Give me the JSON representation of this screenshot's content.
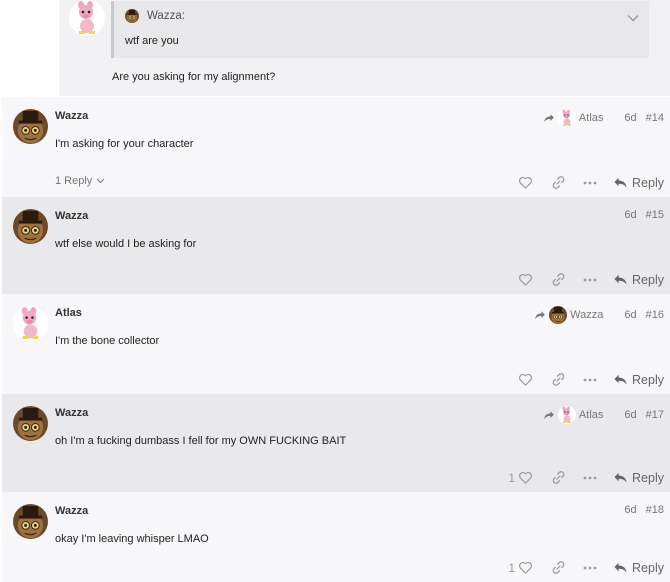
{
  "top": {
    "quote_author": "Wazza:",
    "quote_text": "wtf are you",
    "text": "Are you asking for my alignment?"
  },
  "posts": [
    {
      "username": "Wazza",
      "text": "I'm asking for your character",
      "reply_to": "Atlas",
      "date": "6d",
      "number": "#14",
      "replies": "1 Reply",
      "likes": "",
      "reply_label": "Reply"
    },
    {
      "username": "Wazza",
      "text": "wtf else would I be asking for",
      "reply_to": "",
      "date": "6d",
      "number": "#15",
      "replies": "",
      "likes": "",
      "reply_label": "Reply"
    },
    {
      "username": "Atlas",
      "text": "I'm the bone collector",
      "reply_to": "Wazza",
      "date": "6d",
      "number": "#16",
      "replies": "",
      "likes": "",
      "reply_label": "Reply"
    },
    {
      "username": "Wazza",
      "text": "oh I'm a fucking dumbass I fell for my OWN FUCKING BAIT",
      "reply_to": "Atlas",
      "date": "6d",
      "number": "#17",
      "replies": "",
      "likes": "1",
      "reply_label": "Reply"
    },
    {
      "username": "Wazza",
      "text": "okay I'm leaving whisper LMAO",
      "reply_to": "",
      "date": "6d",
      "number": "#18",
      "replies": "",
      "likes": "1",
      "reply_label": "Reply"
    }
  ],
  "icons": {
    "like": "heart-icon",
    "link": "link-icon",
    "more": "ellipsis-icon",
    "reply": "reply-arrow-icon"
  }
}
